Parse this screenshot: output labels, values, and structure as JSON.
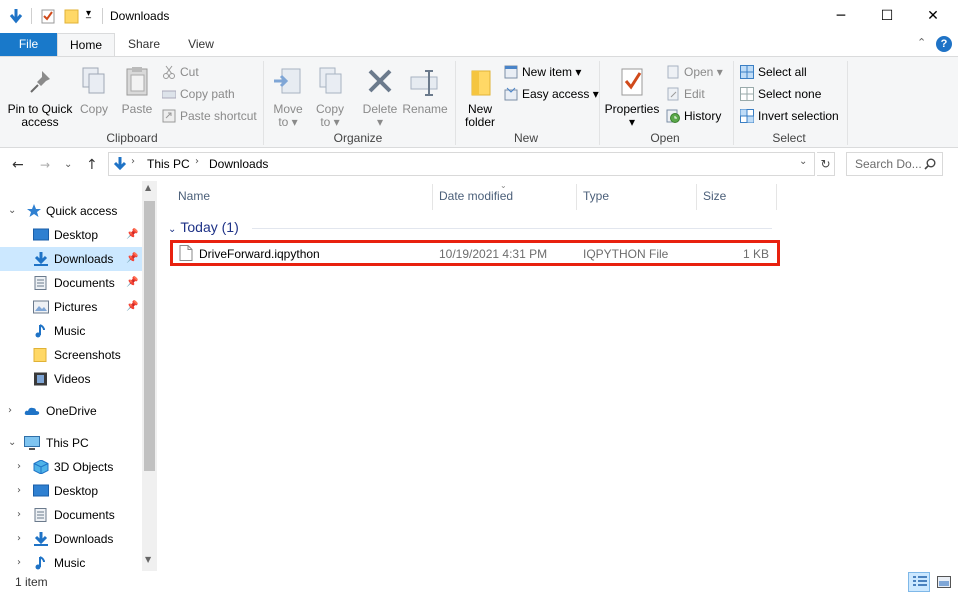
{
  "window": {
    "title": "Downloads",
    "minimize_glyph": "─",
    "maximize_glyph": "☐",
    "close_glyph": "✕"
  },
  "ribbon_tabs": {
    "file": "File",
    "home": "Home",
    "share": "Share",
    "view": "View"
  },
  "ribbon": {
    "clipboard": {
      "group_label": "Clipboard",
      "pin_line1": "Pin to Quick",
      "pin_line2": "access",
      "copy": "Copy",
      "paste": "Paste",
      "cut": "Cut",
      "copy_path": "Copy path",
      "paste_shortcut": "Paste shortcut"
    },
    "organize": {
      "group_label": "Organize",
      "move_line1": "Move",
      "move_line2": "to ▾",
      "copy_line1": "Copy",
      "copy_line2": "to ▾",
      "delete_line1": "Delete",
      "delete_line2": "▾",
      "rename": "Rename"
    },
    "new": {
      "group_label": "New",
      "folder_line1": "New",
      "folder_line2": "folder",
      "new_item": "New item ▾",
      "easy_access": "Easy access ▾"
    },
    "open": {
      "group_label": "Open",
      "properties_line1": "Properties",
      "properties_line2": "▾",
      "open": "Open ▾",
      "edit": "Edit",
      "history": "History"
    },
    "select": {
      "group_label": "Select",
      "select_all": "Select all",
      "select_none": "Select none",
      "invert_selection": "Invert selection"
    }
  },
  "address": {
    "crumbs": [
      "This PC",
      "Downloads"
    ],
    "search_placeholder": "Search Do..."
  },
  "nav": {
    "quick_access": "Quick access",
    "quick_items": [
      "Desktop",
      "Downloads",
      "Documents",
      "Pictures",
      "Music",
      "Screenshots",
      "Videos"
    ],
    "onedrive": "OneDrive",
    "this_pc": "This PC",
    "pc_items": [
      "3D Objects",
      "Desktop",
      "Documents",
      "Downloads",
      "Music"
    ]
  },
  "columns": {
    "name": "Name",
    "date_modified": "Date modified",
    "type": "Type",
    "size": "Size"
  },
  "group": {
    "header": "Today (1)"
  },
  "files": [
    {
      "name": "DriveForward.iqpython",
      "date_modified": "10/19/2021 4:31 PM",
      "type": "IQPYTHON File",
      "size": "1 KB"
    }
  ],
  "status": {
    "item_count": "1 item"
  },
  "colors": {
    "accent": "#1979ca",
    "highlight_border": "#e8210f",
    "nav_selected": "#cce8ff",
    "group_header": "#1e3287"
  }
}
